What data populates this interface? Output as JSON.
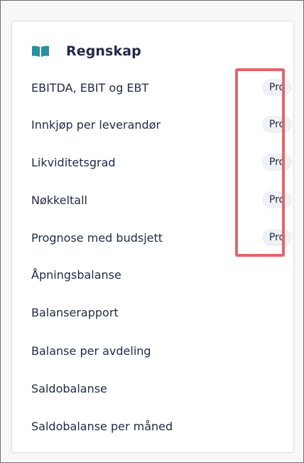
{
  "section": {
    "title": "Regnskap",
    "icon": "book-open-icon",
    "accent_color": "#2a8fa0"
  },
  "items": [
    {
      "label": "EBITDA, EBIT og EBT",
      "badge": "Pro"
    },
    {
      "label": "Innkjøp per leverandør",
      "badge": "Pro"
    },
    {
      "label": "Likviditetsgrad",
      "badge": "Pro"
    },
    {
      "label": "Nøkkeltall",
      "badge": "Pro"
    },
    {
      "label": "Prognose med budsjett",
      "badge": "Pro"
    },
    {
      "label": "Åpningsbalanse"
    },
    {
      "label": "Balanserapport"
    },
    {
      "label": "Balanse per avdeling"
    },
    {
      "label": "Saldobalanse"
    },
    {
      "label": "Saldobalanse per måned"
    }
  ],
  "highlight_color": "#e8636b"
}
